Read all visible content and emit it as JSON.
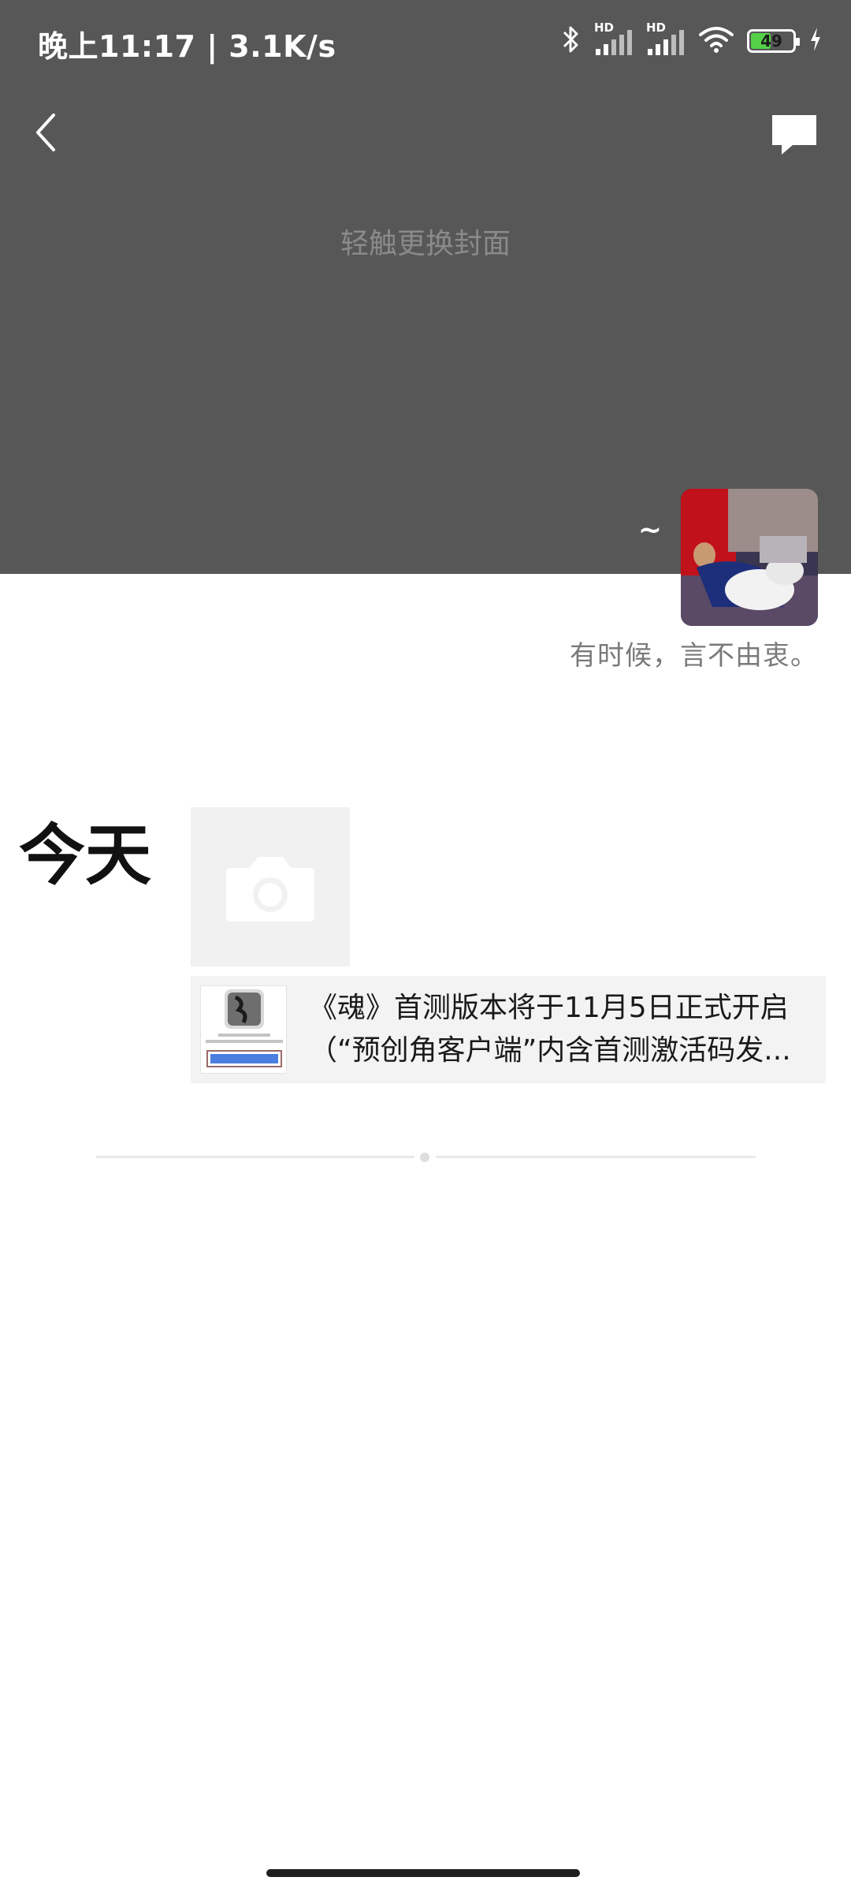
{
  "status_bar": {
    "time_speed": "晚上11:17 | 3.1K/s",
    "battery_level": "49",
    "battery_fraction": 0.49,
    "hd_label": "HD",
    "icons": [
      "bluetooth-icon",
      "signal-hd-icon",
      "signal-hd-icon",
      "wifi-icon",
      "battery-icon",
      "charging-icon"
    ]
  },
  "header": {
    "back_icon": "back-arrow-icon",
    "comment_icon": "comment-icon",
    "cover_hint": "轻触更换封面",
    "background_color": "#575757"
  },
  "profile": {
    "nickname": "~",
    "signature": "有时候，言不由衷。"
  },
  "feed": {
    "day_label": "今天",
    "camera_icon": "camera-icon",
    "share_card": {
      "title_line1": "《魂》首测版本将于11月5日正式开启",
      "title_line2": "（“预创角客户端”内含首测激活码发..."
    }
  },
  "colors": {
    "battery_fill": "#54d147",
    "cover": "#575757",
    "card_bg": "#f3f3f3",
    "link_blue": "#4a7fe0"
  }
}
